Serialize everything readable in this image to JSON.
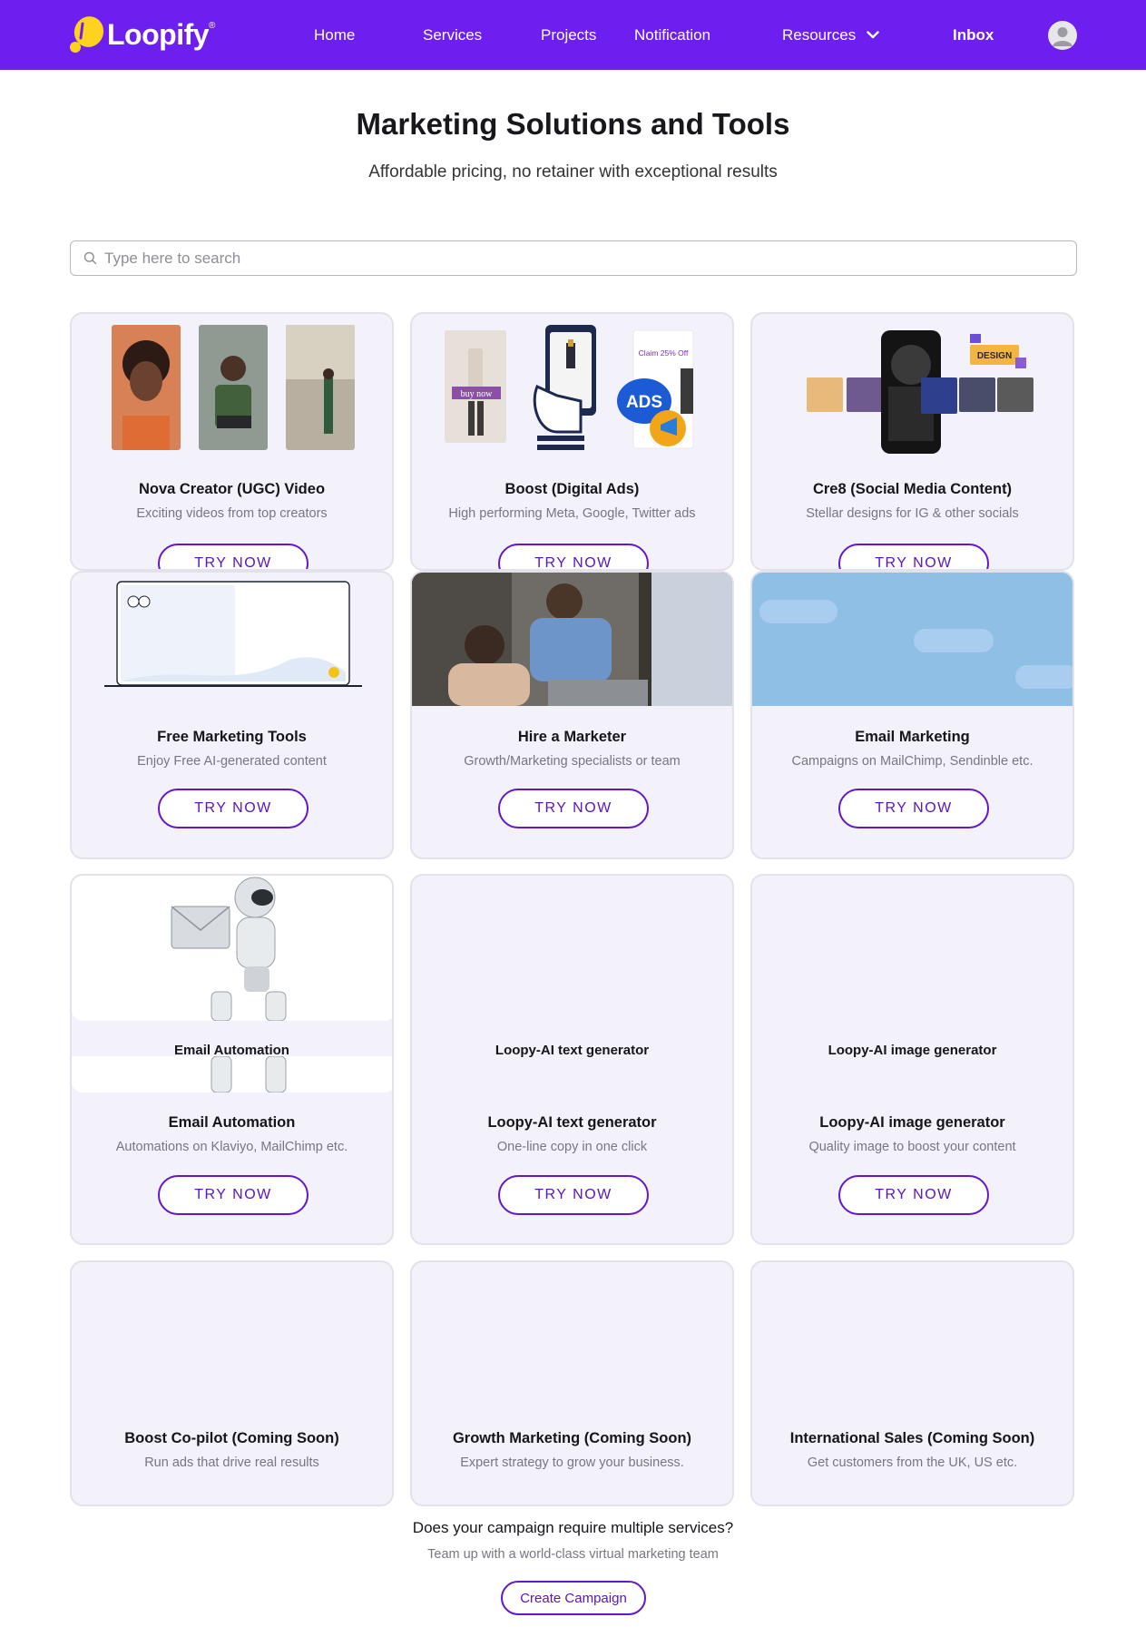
{
  "nav": {
    "logo_text": "Loopify",
    "logo_reg": "®",
    "items": [
      "Home",
      "Services",
      "Projects",
      "Notification",
      "Resources",
      "Inbox"
    ]
  },
  "hero": {
    "title": "Marketing Solutions and Tools",
    "subtitle": "Affordable pricing, no retainer with exceptional results"
  },
  "search": {
    "placeholder": "Type here to search"
  },
  "cta_label": "TRY NOW",
  "image_text": {
    "buy_now": "buy now",
    "claim": "Claim 25% Off",
    "ads": "ADS",
    "design": "DESIGN"
  },
  "cards": [
    {
      "title": "Nova Creator (UGC) Video",
      "desc": "Exciting videos from top creators"
    },
    {
      "title": "Boost (Digital Ads)",
      "desc": "High performing Meta, Google, Twitter ads"
    },
    {
      "title": "Cre8 (Social Media Content)",
      "desc": "Stellar designs for IG & other socials"
    },
    {
      "title": "Free Marketing Tools",
      "desc": "Enjoy Free AI-generated content"
    },
    {
      "title": "Hire a Marketer",
      "desc": "Growth/Marketing specialists or team"
    },
    {
      "title": "Email Marketing",
      "desc": "Campaigns on MailChimp, Sendinble etc."
    },
    {
      "title": "Email Automation",
      "desc": "Automations on Klaviyo, MailChimp etc.",
      "ghost": "Email Automation"
    },
    {
      "title": "Loopy-AI text generator",
      "desc": "One-line copy in one click",
      "ghost": "Loopy-AI text generator"
    },
    {
      "title": "Loopy-AI image generator",
      "desc": "Quality image to boost your content",
      "ghost": "Loopy-AI image generator"
    },
    {
      "title": "Boost Co-pilot (Coming Soon)",
      "desc": "Run ads that drive real results"
    },
    {
      "title": "Growth Marketing (Coming Soon)",
      "desc": "Expert strategy to grow your business."
    },
    {
      "title": "International Sales (Coming Soon)",
      "desc": "Get customers from the UK, US etc."
    }
  ],
  "footer": {
    "question": "Does your campaign require multiple services?",
    "team": "Team up with a world-class virtual marketing team",
    "button": "Create Campaign"
  },
  "colors": {
    "brand": "#6d1ff0",
    "accent": "#6416c9",
    "card_bg": "#f3f1f9"
  }
}
